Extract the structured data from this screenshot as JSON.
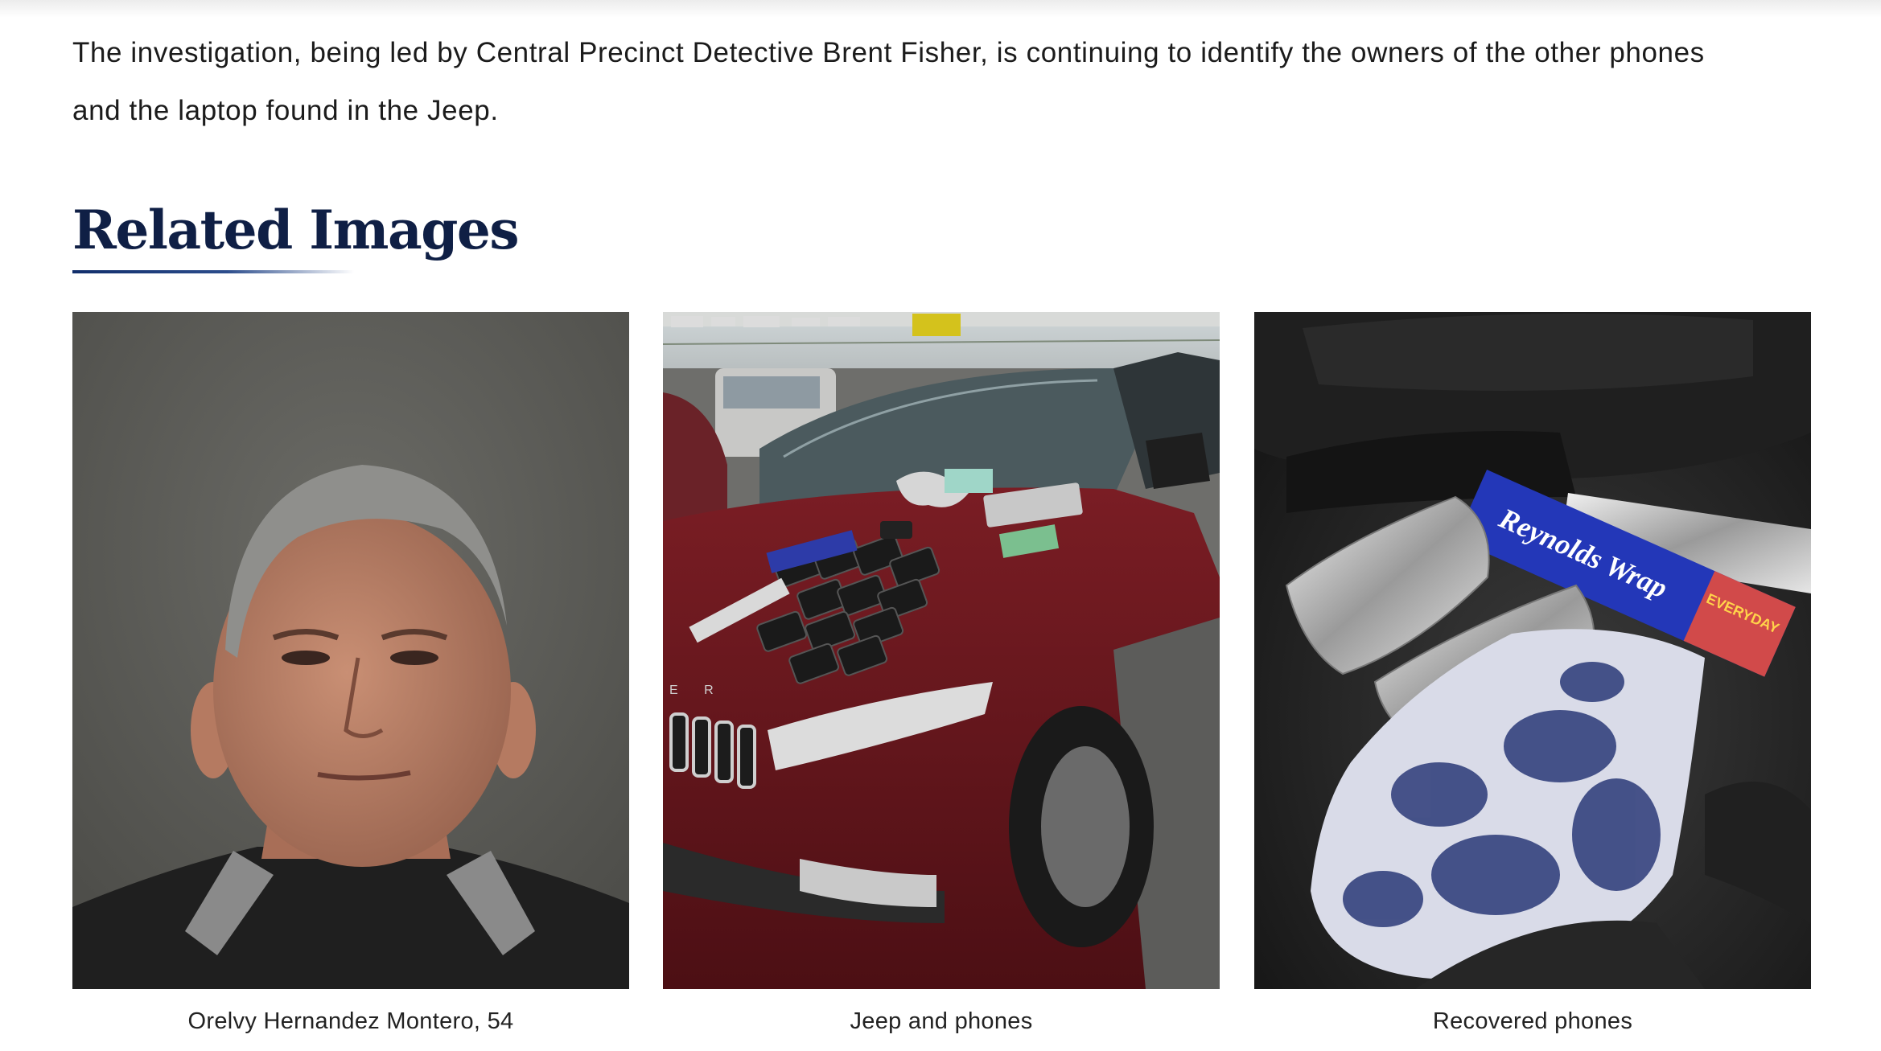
{
  "article": {
    "paragraph_line1": "The investigation, being led by Central Precinct Detective Brent Fisher, is continuing to identify the owners of the other phones",
    "paragraph_line2": "and the laptop found in the Jeep."
  },
  "related": {
    "heading": "Related Images",
    "images": [
      {
        "caption": "Orelvy Hernandez Montero, 54"
      },
      {
        "caption": "Jeep and phones"
      },
      {
        "caption": "Recovered phones"
      }
    ]
  },
  "photo_text": {
    "foil_box_brand": "Reynolds Wrap",
    "foil_box_tag": "EVERYDAY",
    "grille_letters": "E R"
  },
  "colors": {
    "heading": "#0f1f45",
    "underline": "#112e6b",
    "text": "#1b1b1b"
  }
}
